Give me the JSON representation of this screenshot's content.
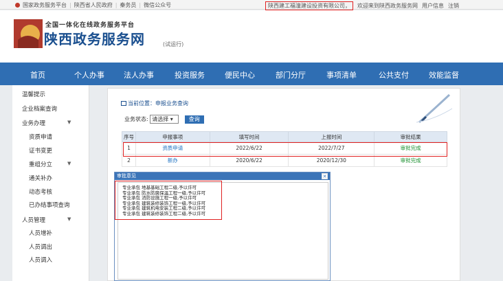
{
  "topbar": {
    "links": [
      "国家政务服务平台",
      "陕西省人民政府",
      "秦务员",
      "微信公众号"
    ],
    "company": "陕西建工福潼建设投资有限公司，",
    "welcome": "欢迎来到陕西政务服务网",
    "user_info": "用户信息",
    "logout": "注销"
  },
  "header": {
    "platform": "全国一体化在线政务服务平台",
    "site_name": "陕西政务服务网",
    "trial": "(试运行)"
  },
  "nav": {
    "items": [
      "首页",
      "个人办事",
      "法人办事",
      "投资服务",
      "便民中心",
      "部门分厅",
      "事项清单",
      "公共支付",
      "效能监督"
    ]
  },
  "sidebar": {
    "items": [
      {
        "label": "温馨提示"
      },
      {
        "label": "企业档案查询"
      },
      {
        "label": "业务办理"
      },
      {
        "label": "资质申请"
      },
      {
        "label": "证书变更"
      },
      {
        "label": "重组分立"
      },
      {
        "label": "通关补办"
      },
      {
        "label": "动态考核"
      },
      {
        "label": "已办结事项查询"
      },
      {
        "label": "人员管理"
      },
      {
        "label": "人员增补"
      },
      {
        "label": "人员调出"
      },
      {
        "label": "人员调入"
      }
    ]
  },
  "breadcrumb": {
    "current": "当前位置：",
    "page": "申报业务查询"
  },
  "filter": {
    "label": "业务状态:",
    "select_value": "请选择",
    "query_button": "查询"
  },
  "table": {
    "headers": [
      "序号",
      "申报事项",
      "填写时间",
      "上报时间",
      "审批结果"
    ],
    "rows": [
      [
        "1",
        "资质申请",
        "2022/6/22",
        "2022/7/27",
        "审批完成"
      ],
      [
        "2",
        "新办",
        "2020/6/22",
        "2020/12/30",
        "审批完成"
      ]
    ]
  },
  "dialog": {
    "title": "审批意见",
    "close": "✕",
    "lines": [
      "专业承包 地基基础工程二级,予以许可",
      "专业承包 防水防腐保温工程一级,予以许可",
      "专业承包 消防设施工程一级,予以许可",
      "专业承包 建筑装修装饰工程一级,予以许可",
      "专业承包 建筑机电安装工程二级,予以许可",
      "专业承包 建筑装修装饰工程二级,予以许可"
    ]
  },
  "colors": {
    "nav": "#2f6eb3",
    "highlight": "#e02020",
    "link": "#1a6fc0",
    "success": "#1a8f2f"
  }
}
